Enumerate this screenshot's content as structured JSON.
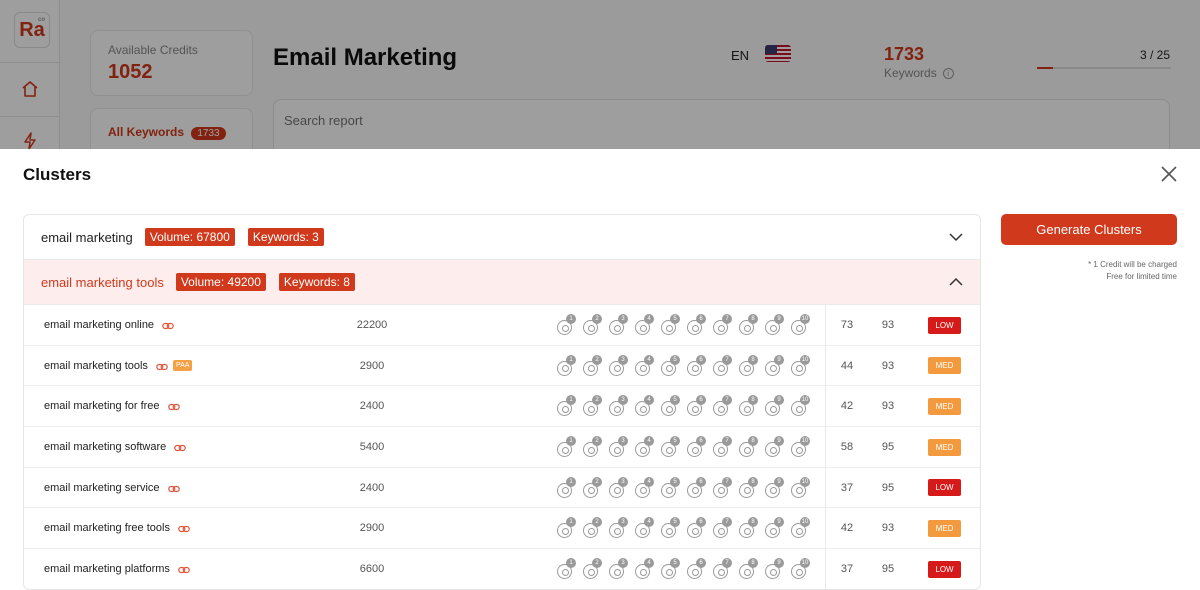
{
  "app": {
    "logo": "Ra",
    "logo_sup": "co",
    "credits_label": "Available Credits",
    "credits_value": "1052",
    "all_keywords_label": "All Keywords",
    "all_keywords_count": "1733",
    "page_title": "Email Marketing",
    "language": "EN",
    "keywords_count": "1733",
    "keywords_label": "Keywords",
    "progress_text": "3 / 25",
    "progress_fraction": 0.12,
    "search_placeholder": "Search report"
  },
  "modal": {
    "title": "Clusters",
    "generate_label": "Generate Clusters",
    "note_line1": "* 1 Credit will be charged",
    "note_line2": "Free for limited time"
  },
  "clusters": [
    {
      "name": "email marketing",
      "volume_tag": "Volume: 67800",
      "keywords_tag": "Keywords: 3",
      "open": false
    },
    {
      "name": "email marketing tools",
      "volume_tag": "Volume: 49200",
      "keywords_tag": "Keywords: 8",
      "open": true
    }
  ],
  "serp_positions": [
    "1",
    "2",
    "3",
    "4",
    "5",
    "6",
    "7",
    "8",
    "9",
    "10"
  ],
  "rows": [
    {
      "keyword": "email marketing online",
      "paa": "",
      "volume": "22200",
      "kd": "73",
      "cpc": "93",
      "competition": "LOW"
    },
    {
      "keyword": "email marketing tools",
      "paa": "PAA",
      "volume": "2900",
      "kd": "44",
      "cpc": "93",
      "competition": "MED"
    },
    {
      "keyword": "email marketing for free",
      "paa": "",
      "volume": "2400",
      "kd": "42",
      "cpc": "93",
      "competition": "MED"
    },
    {
      "keyword": "email marketing software",
      "paa": "",
      "volume": "5400",
      "kd": "58",
      "cpc": "95",
      "competition": "MED"
    },
    {
      "keyword": "email marketing service",
      "paa": "",
      "volume": "2400",
      "kd": "37",
      "cpc": "95",
      "competition": "LOW"
    },
    {
      "keyword": "email marketing free tools",
      "paa": "",
      "volume": "2900",
      "kd": "42",
      "cpc": "93",
      "competition": "MED"
    },
    {
      "keyword": "email marketing platforms",
      "paa": "",
      "volume": "6600",
      "kd": "37",
      "cpc": "95",
      "competition": "LOW"
    }
  ],
  "colors": {
    "accent": "#d0391b",
    "low": "#d61a1a",
    "med": "#f39a3e",
    "open_row_bg": "#fdeeed"
  },
  "icons": {
    "home": "home-icon",
    "bolt": "bolt-icon",
    "close": "close-icon",
    "chevron_down": "chevron-down-icon",
    "chevron_up": "chevron-up-icon",
    "link": "link-icon",
    "serp": "serp-rank-icon",
    "info": "info-icon"
  }
}
